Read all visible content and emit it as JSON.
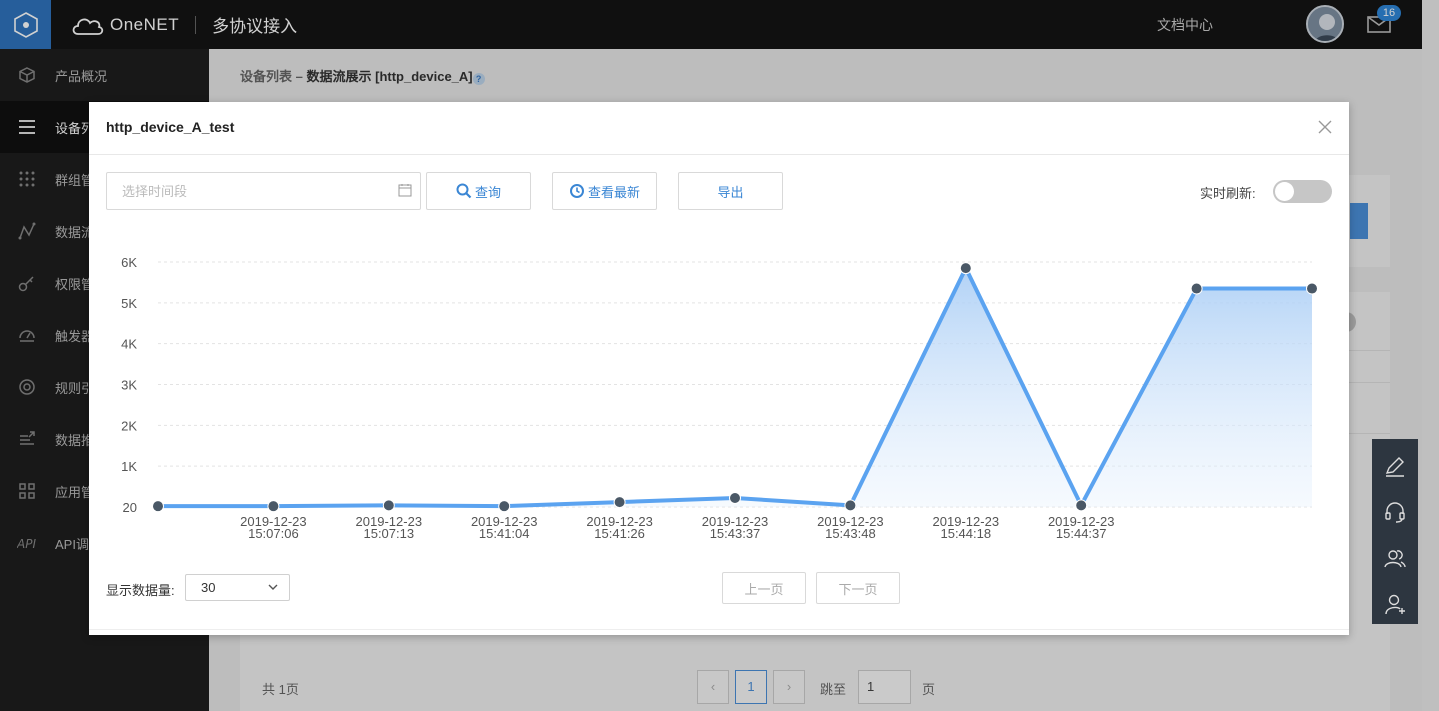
{
  "header": {
    "brand": "OneNET",
    "product": "多协议接入",
    "doc_link": "文档中心",
    "notification_count": "16"
  },
  "sidebar": {
    "items": [
      {
        "label": "产品概况",
        "icon": "cube-icon"
      },
      {
        "label": "设备列",
        "icon": "list-icon"
      },
      {
        "label": "群组管",
        "icon": "grid-dots-icon"
      },
      {
        "label": "数据流",
        "icon": "data-stream-icon"
      },
      {
        "label": "权限管",
        "icon": "key-icon"
      },
      {
        "label": "触发器",
        "icon": "trigger-icon"
      },
      {
        "label": "规则引",
        "icon": "rule-engine-icon"
      },
      {
        "label": "数据推",
        "icon": "data-push-icon"
      },
      {
        "label": "应用管",
        "icon": "apps-icon"
      },
      {
        "label": "API调",
        "icon": "api-icon"
      }
    ]
  },
  "breadcrumb": {
    "parent": "设备列表",
    "separator": "–",
    "current": "数据流展示 [http_device_A]",
    "help": "?"
  },
  "background_pager": {
    "total": "共 1页",
    "prev": "‹",
    "current_page": "1",
    "next": "›",
    "jump_label": "跳至",
    "jump_value": "1",
    "page_unit": "页"
  },
  "modal": {
    "title": "http_device_A_test",
    "date_placeholder": "选择时间段",
    "query_label": "查询",
    "latest_label": "查看最新",
    "export_label": "导出",
    "realtime_label": "实时刷新:",
    "realtime_on": false,
    "count_label": "显示数据量:",
    "count_value": "30",
    "prev_page": "上一页",
    "next_page": "下一页"
  },
  "colors": {
    "accent": "#3a86d4",
    "line": "#5ba3f0",
    "sidebar_bg": "#1e1e1e",
    "topbar_bg": "#141414",
    "logo_bg": "#2f73bd"
  },
  "chart_data": {
    "type": "area",
    "y_ticks": [
      "6K",
      "5K",
      "4K",
      "3K",
      "2K",
      "1K",
      "20"
    ],
    "ylim": [
      0,
      6000
    ],
    "x_labels": [
      [
        "2019-12-23",
        "15:07:06"
      ],
      [
        "2019-12-23",
        "15:07:13"
      ],
      [
        "2019-12-23",
        "15:41:04"
      ],
      [
        "2019-12-23",
        "15:41:26"
      ],
      [
        "2019-12-23",
        "15:43:37"
      ],
      [
        "2019-12-23",
        "15:43:48"
      ],
      [
        "2019-12-23",
        "15:44:18"
      ],
      [
        "2019-12-23",
        "15:44:37"
      ]
    ],
    "values": [
      20,
      20,
      40,
      20,
      120,
      220,
      40,
      5850,
      40,
      5350,
      5350
    ],
    "grid": true,
    "legend": "none"
  }
}
